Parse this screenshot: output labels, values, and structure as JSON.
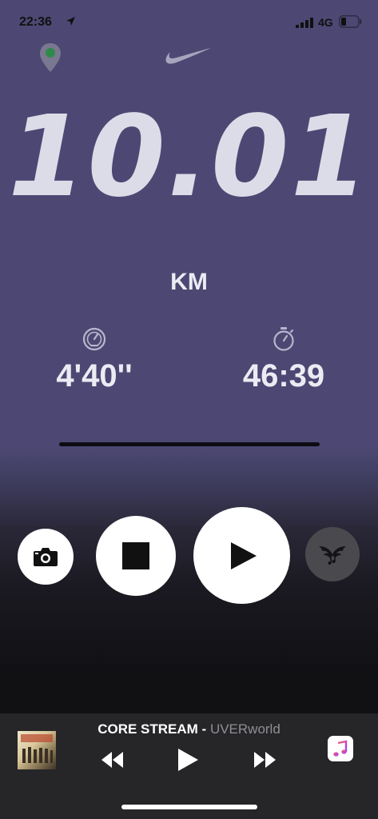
{
  "status_bar": {
    "time": "22:36",
    "network": "4G",
    "icons": [
      "location-arrow-icon",
      "signal-bars-icon",
      "battery-icon"
    ]
  },
  "header": {
    "icons": [
      "map-pin-icon",
      "nike-swoosh-logo"
    ]
  },
  "run": {
    "distance": "10.01",
    "distance_unit": "KM",
    "pace": "4'40''",
    "duration": "46:39",
    "pace_icon": "speedometer-icon",
    "duration_icon": "stopwatch-icon"
  },
  "controls": [
    "camera-icon",
    "stop-icon",
    "play-icon",
    "powersong-wings-icon"
  ],
  "now_playing": {
    "title": "CORE STREAM",
    "separator": " - ",
    "artist": "UVERworld",
    "buttons": [
      "rewind-icon",
      "play-icon",
      "fast-forward-icon",
      "apple-music-icon"
    ]
  },
  "colors": {
    "background": "#4c4873",
    "text": "#dcdce8",
    "player_bar": "#262629"
  }
}
